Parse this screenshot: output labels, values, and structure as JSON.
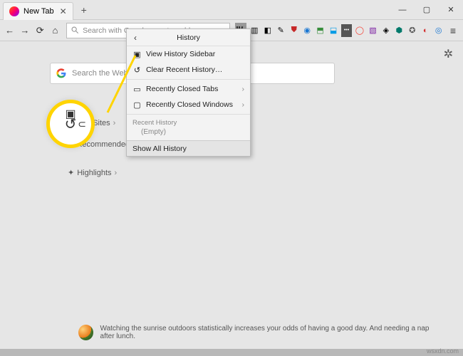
{
  "window": {
    "tab_title": "New Tab",
    "min": "—",
    "max": "▢",
    "close": "✕",
    "newtab": "+"
  },
  "toolbar": {
    "url_placeholder": "Search with Google or enter address",
    "menu": "≡"
  },
  "page": {
    "search_placeholder": "Search the Web",
    "top_sites": "Top Sites",
    "recommended": "Recommended by Pocket",
    "highlights": "Highlights",
    "chev": "›"
  },
  "dropdown": {
    "title": "History",
    "view_sidebar": "View History Sidebar",
    "clear_recent": "Clear Recent History…",
    "closed_tabs": "Recently Closed Tabs",
    "closed_windows": "Recently Closed Windows",
    "recent_group": "Recent History",
    "empty": "(Empty)",
    "show_all": "Show All History"
  },
  "snippet": "Watching the sunrise outdoors statistically increases your odds of having a good day. And needing a nap after lunch.",
  "watermark": "wsxdn.com"
}
